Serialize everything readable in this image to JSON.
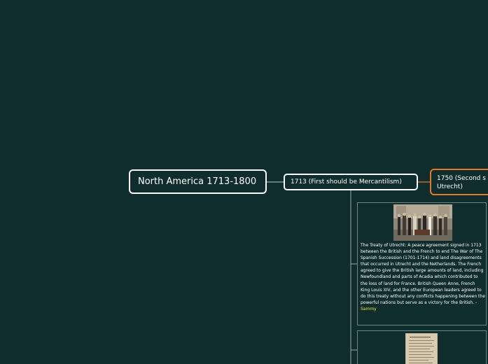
{
  "diagram": {
    "root": {
      "label": "North America 1713-1800"
    },
    "branches": [
      {
        "label": "1713  (First should be Mercantilism)"
      },
      {
        "label": "1750 (Second s Utrecht)"
      }
    ],
    "notes": {
      "treaty_text": "The Treaty of Utrecht: A peace agreement signed in 1713 between the British and the French to end The War of The Spanish Succession (1701-1714) and land disagreements that occurred in Utrecht and the Netherlands. The French agreed to give the British large amounts of land, including Newfoundland and parts of Acadia which contributed to the loss of land for France. British Queen Anne, French King Louis XIV, and the other European leaders agreed to do this treaty without any conflicts happening between the powerful nations but serve as a victory for the British. -",
      "author": "Sammy"
    },
    "colors": {
      "background": "#0f2d2c",
      "node_border": "#ffffff",
      "highlight_border": "#e87722",
      "connector": "#9aa9a8",
      "author": "#f0e23c"
    }
  }
}
